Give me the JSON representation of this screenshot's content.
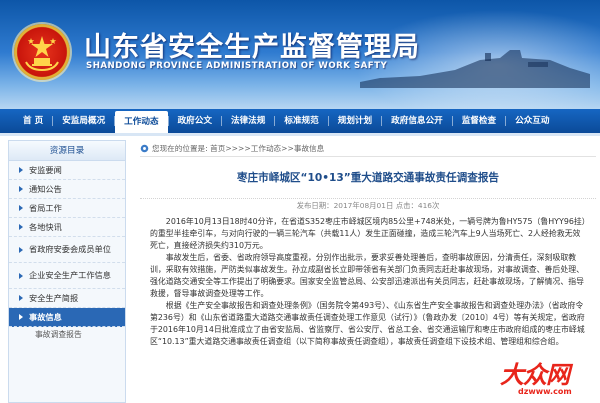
{
  "header": {
    "title": "山东省安全生产监督管理局",
    "subtitle": "SHANDONG PROVINCE ADMINISTRATION OF WORK SAFTY"
  },
  "nav": {
    "items": [
      "首 页",
      "安监局概况",
      "工作动态",
      "政府公文",
      "法律法规",
      "标准规范",
      "规划计划",
      "政府信息公开",
      "监督检查",
      "公众互动"
    ],
    "active_index": 2
  },
  "sidebar": {
    "heading": "资源目录",
    "items": [
      {
        "label": "安监要闻"
      },
      {
        "label": "通知公告"
      },
      {
        "label": "省局工作"
      },
      {
        "label": "各地快讯"
      },
      {
        "label": "省政府安委会成员单位"
      },
      {
        "label": "企业安全生产工作信息"
      },
      {
        "label": "安全生产简报"
      },
      {
        "label": "事故信息"
      }
    ],
    "sub_items": [
      "事故调查报告"
    ]
  },
  "breadcrumb": {
    "text": "您现在的位置是: 首页>>>>工作动态>>事故信息"
  },
  "article": {
    "title": "枣庄市峄城区“10•13”重大道路交通事故责任调查报告",
    "meta": "发布日期：2017年08月01日    点击：416次",
    "paragraphs": [
      "2016年10月13日18时40分许，在省道S352枣庄市峄城区境内85公里+748米处，一辆号牌为鲁HY575（鲁HYY96挂）的重型半挂牵引车，与对向行驶的一辆三轮汽车（共载11人）发生正面碰撞，造成三轮汽车上9人当场死亡、2人经抢救无效死亡，直接经济损失约310万元。",
      "事故发生后，省委、省政府领导高度重视，分别作出批示，要求妥善处理善后，查明事故原因，分清责任，深刻吸取教训，采取有效措施，严防类似事故发生。孙立成副省长立即带领省有关部门负责同志赶赴事故现场，对事故调查、善后处理、强化道路交通安全等工作提出了明确要求。国家安全监管总局、公安部迅速派出有关员同志，赶赴事故现场，了解情况、指导救援，督导事故调查处理等工作。",
      "根据《生产安全事故报告和调查处理条例》（国务院令第493号）、《山东省生产安全事故报告和调查处理办法》（省政府令第236号）和《山东省道路重大道路交通事故责任调查处理工作意见（试行）》（鲁政办发〔2010〕4号）等有关规定，省政府于2016年10月14日批准成立了由省安监局、省监察厅、省公安厅、省总工会、省交通运输厅和枣庄市政府组成的枣庄市峄城区“10.13”重大道路交通事故责任调查组（以下简称事故责任调查组），事故责任调查组下设技术组、管理组和综合组。"
    ]
  },
  "watermark": {
    "logo": "大众网",
    "url": "dzwww.com"
  },
  "colors": {
    "nav_bg": "#0b4a98",
    "title_blue": "#1f4d8a",
    "sidebar_active": "#2a68b5",
    "watermark_red": "#e8251b"
  },
  "icons": {
    "emblem": "national-emblem-icon",
    "breadcrumb": "location-icon",
    "sidebar_bullet": "triangle-arrow-icon"
  }
}
